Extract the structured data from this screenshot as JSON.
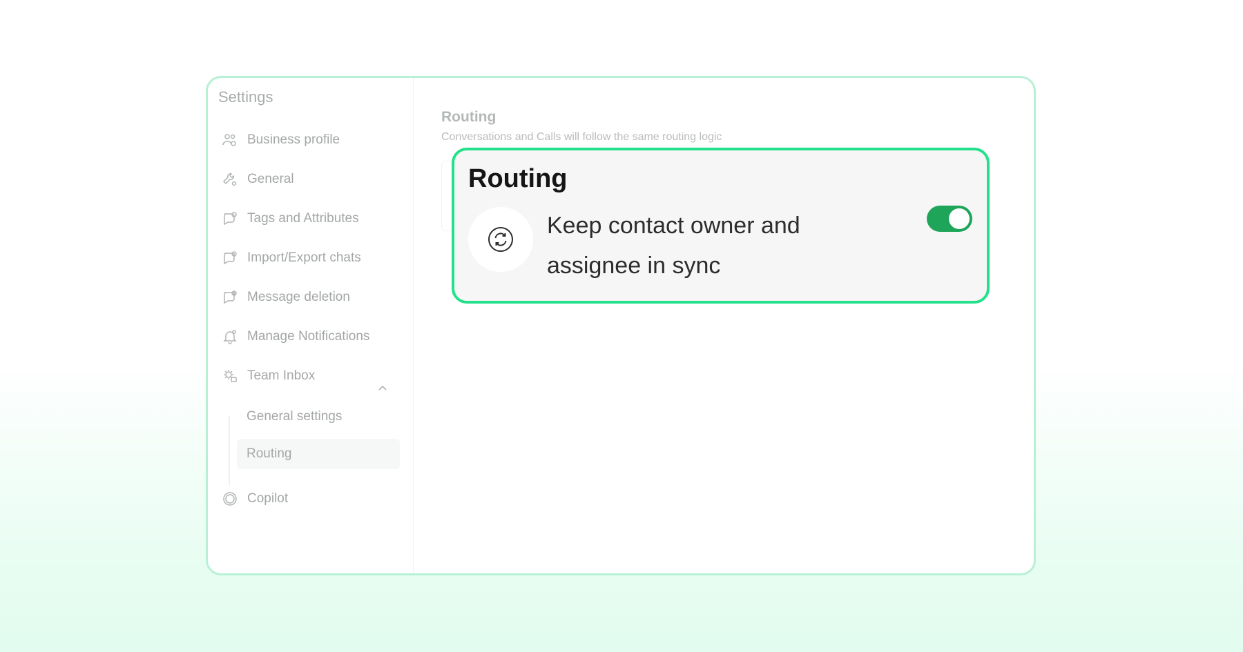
{
  "sidebar": {
    "title": "Settings",
    "items": [
      {
        "label": "Business profile",
        "icon": "users-gear-icon"
      },
      {
        "label": "General",
        "icon": "wrench-gear-icon"
      },
      {
        "label": "Tags and Attributes",
        "icon": "chat-tag-icon"
      },
      {
        "label": "Import/Export chats",
        "icon": "chat-transfer-icon"
      },
      {
        "label": "Message deletion",
        "icon": "chat-delete-icon"
      },
      {
        "label": "Manage Notifications",
        "icon": "bell-icon"
      },
      {
        "label": "Team Inbox",
        "icon": "team-inbox-icon"
      },
      {
        "label": "Copilot",
        "icon": "copilot-icon"
      }
    ],
    "sub_items": [
      {
        "label": "General settings"
      },
      {
        "label": "Routing",
        "active": true
      }
    ]
  },
  "main": {
    "heading": "Routing",
    "subheading": "Conversations and Calls will follow the same routing logic"
  },
  "callout": {
    "title": "Routing",
    "description": "Keep contact owner and assignee in sync",
    "icon": "sync-icon",
    "toggle_on": true
  },
  "colors": {
    "accent_border": "#22e18a",
    "toggle_on": "#1fa55a",
    "window_border": "#b8f0d6"
  }
}
